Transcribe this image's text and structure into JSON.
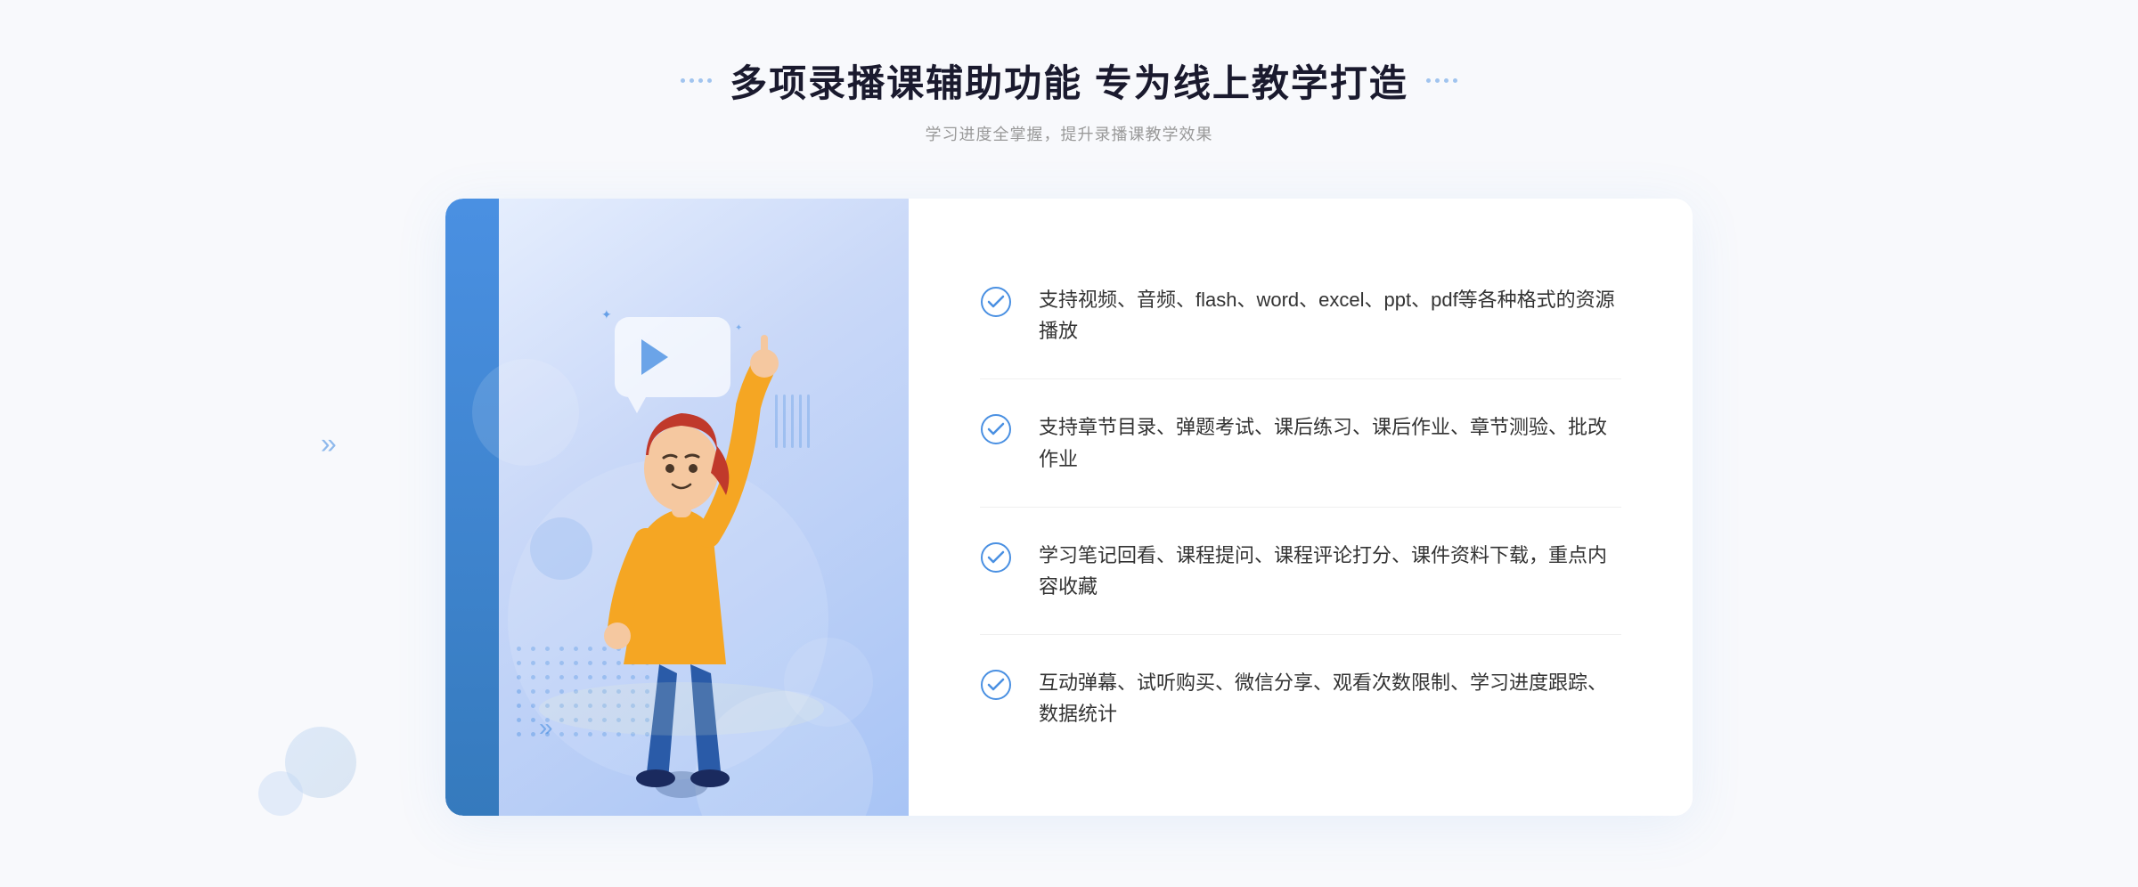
{
  "header": {
    "main_title": "多项录播课辅助功能 专为线上教学打造",
    "sub_title": "学习进度全掌握，提升录播课教学效果"
  },
  "features": [
    {
      "id": 1,
      "text": "支持视频、音频、flash、word、excel、ppt、pdf等各种格式的资源播放"
    },
    {
      "id": 2,
      "text": "支持章节目录、弹题考试、课后练习、课后作业、章节测验、批改作业"
    },
    {
      "id": 3,
      "text": "学习笔记回看、课程提问、课程评论打分、课件资料下载，重点内容收藏"
    },
    {
      "id": 4,
      "text": "互动弹幕、试听购买、微信分享、观看次数限制、学习进度跟踪、数据统计"
    }
  ],
  "colors": {
    "accent": "#4a90e2",
    "title": "#1a1a2e",
    "text": "#333333",
    "subtitle": "#999999",
    "check": "#4a90e2",
    "bg": "#f8f9fc"
  },
  "icons": {
    "check": "check-circle",
    "play": "play-triangle",
    "arrow": "chevron-right"
  }
}
